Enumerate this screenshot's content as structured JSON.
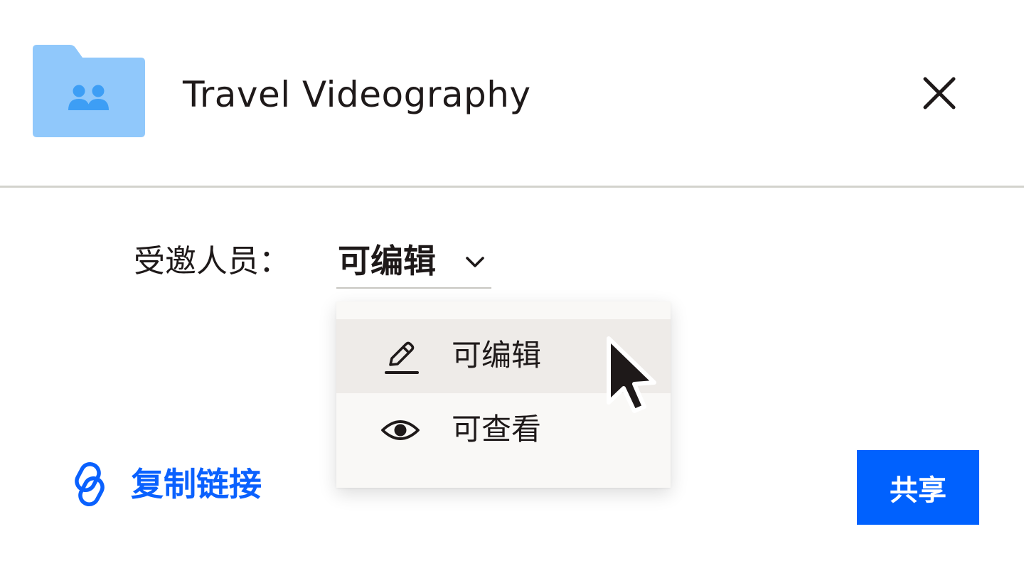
{
  "header": {
    "title": "Travel Videography",
    "folder_icon": "shared-folder-icon",
    "close_icon": "close-icon"
  },
  "invitees": {
    "label": "受邀人员：",
    "selected_permission": "可编辑"
  },
  "permission_menu": {
    "items": [
      {
        "label": "可编辑",
        "icon": "pencil-icon",
        "highlighted": true
      },
      {
        "label": "可查看",
        "icon": "eye-icon",
        "highlighted": false
      }
    ]
  },
  "footer": {
    "copy_link_label": "复制链接",
    "share_label": "共享"
  },
  "colors": {
    "folder": "#90c8fb",
    "folder_glyph": "#3d9ef5",
    "accent": "#0061fe",
    "menu_bg": "#f9f8f6",
    "menu_highlight": "#eeebe8",
    "divider": "#d3d3cd",
    "text": "#1e1919"
  }
}
